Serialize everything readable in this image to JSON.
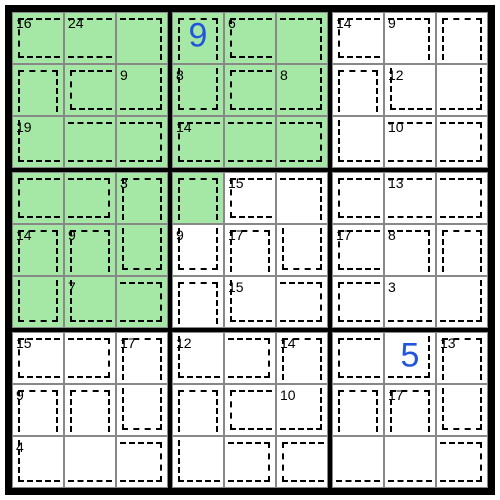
{
  "grid": {
    "size": 9,
    "boxes": 3,
    "highlight_color": "#a5e8a5",
    "entry_color": "#2255dd"
  },
  "cells": [
    [
      {
        "cage": "16",
        "hl": true,
        "o": "r"
      },
      {
        "cage": "24",
        "hl": true,
        "o": "lr"
      },
      {
        "hl": true,
        "o": "lb"
      },
      {
        "hl": true,
        "entry": "9",
        "o": "b"
      },
      {
        "cage": "6",
        "hl": true,
        "o": "r"
      },
      {
        "hl": true,
        "o": "lb"
      },
      {
        "cage": "14",
        "o": "r"
      },
      {
        "cage": "9",
        "o": "lb"
      },
      {
        "o": "b"
      }
    ],
    [
      {
        "hl": true,
        "o": "b"
      },
      {
        "hl": true,
        "o": "r"
      },
      {
        "cage": "9",
        "hl": true,
        "o": "lt"
      },
      {
        "cage": "8",
        "hl": true,
        "o": "t"
      },
      {
        "hl": true,
        "o": "r"
      },
      {
        "cage": "8",
        "hl": true,
        "o": "lt"
      },
      {
        "o": "b"
      },
      {
        "cage": "12",
        "o": "tr"
      },
      {
        "o": "lt"
      }
    ],
    [
      {
        "cage": "19",
        "hl": true,
        "o": "tr"
      },
      {
        "hl": true,
        "o": "lr"
      },
      {
        "hl": true,
        "o": "l"
      },
      {
        "cage": "14",
        "hl": true,
        "o": "r"
      },
      {
        "hl": true,
        "o": "lr"
      },
      {
        "hl": true,
        "o": "l"
      },
      {
        "o": "tr"
      },
      {
        "cage": "10",
        "o": "lr"
      },
      {
        "o": "l"
      }
    ],
    [
      {
        "hl": true,
        "o": "r"
      },
      {
        "hl": true,
        "o": "l"
      },
      {
        "cage": "3",
        "hl": true,
        "o": "b"
      },
      {
        "hl": true,
        "o": "b"
      },
      {
        "cage": "15",
        "o": "r"
      },
      {
        "o": "lb"
      },
      {
        "o": "r"
      },
      {
        "cage": "13",
        "o": "lr"
      },
      {
        "o": "l"
      }
    ],
    [
      {
        "cage": "14",
        "hl": true,
        "o": "b"
      },
      {
        "cage": "9",
        "hl": true,
        "o": "b"
      },
      {
        "hl": true,
        "o": "t"
      },
      {
        "cage": "9",
        "o": "t"
      },
      {
        "cage": "17",
        "o": "b"
      },
      {
        "o": "t"
      },
      {
        "cage": "17",
        "o": "r"
      },
      {
        "cage": "8",
        "o": "lb"
      },
      {
        "o": "b"
      }
    ],
    [
      {
        "hl": true,
        "o": "t"
      },
      {
        "cage": "7",
        "hl": true,
        "o": "tr"
      },
      {
        "hl": true,
        "o": "l"
      },
      {
        "o": "b"
      },
      {
        "cage": "15",
        "o": "tr"
      },
      {
        "o": "l"
      },
      {
        "o": "r"
      },
      {
        "cage": "3",
        "o": "ltr"
      },
      {
        "o": "lt"
      }
    ],
    [
      {
        "cage": "15",
        "o": "r"
      },
      {
        "o": "l"
      },
      {
        "cage": "17",
        "o": "b"
      },
      {
        "cage": "12",
        "o": "tr"
      },
      {
        "o": "l"
      },
      {
        "cage": "14",
        "o": "b"
      },
      {
        "o": "r"
      },
      {
        "entry": "5",
        "o": "lt"
      },
      {
        "cage": "13",
        "o": "b"
      }
    ],
    [
      {
        "cage": "9",
        "o": "b"
      },
      {
        "o": "b"
      },
      {
        "o": "t"
      },
      {
        "o": "b"
      },
      {
        "o": "r"
      },
      {
        "cage": "10",
        "o": "lt"
      },
      {
        "o": "b"
      },
      {
        "cage": "17",
        "o": "b"
      },
      {
        "o": "t"
      }
    ],
    [
      {
        "cage": "4",
        "o": "tr"
      },
      {
        "o": "ltr"
      },
      {
        "o": "l"
      },
      {
        "o": "tr"
      },
      {
        "o": "l"
      },
      {
        "o": "r"
      },
      {
        "o": "ltr"
      },
      {
        "o": "ltr"
      },
      {
        "o": "l"
      }
    ]
  ]
}
